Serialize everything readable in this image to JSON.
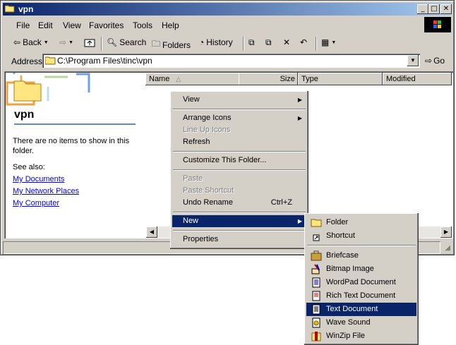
{
  "window": {
    "title": "vpn"
  },
  "menubar": [
    "File",
    "Edit",
    "View",
    "Favorites",
    "Tools",
    "Help"
  ],
  "toolbar": {
    "back": "Back",
    "search": "Search",
    "folders": "Folders",
    "history": "History"
  },
  "address": {
    "label": "Address",
    "value": "C:\\Program Files\\tinc\\vpn",
    "go": "Go"
  },
  "left_panel": {
    "folder_name": "vpn",
    "empty_message": "There are no items to show in this folder.",
    "see_also": "See also:",
    "links": [
      "My Documents",
      "My Network Places",
      "My Computer"
    ]
  },
  "columns": [
    "Name",
    "Size",
    "Type",
    "Modified"
  ],
  "context_menu": {
    "view": "View",
    "arrange_icons": "Arrange Icons",
    "line_up_icons": "Line Up Icons",
    "refresh": "Refresh",
    "customize": "Customize This Folder...",
    "paste": "Paste",
    "paste_shortcut": "Paste Shortcut",
    "undo_rename": "Undo Rename",
    "undo_shortcut": "Ctrl+Z",
    "new": "New",
    "properties": "Properties"
  },
  "new_submenu": {
    "folder": "Folder",
    "shortcut": "Shortcut",
    "briefcase": "Briefcase",
    "bitmap": "Bitmap Image",
    "wordpad": "WordPad Document",
    "rtf": "Rich Text Document",
    "text": "Text Document",
    "wave": "Wave Sound",
    "winzip": "WinZip File"
  },
  "colors": {
    "title_active": "#0a246a",
    "selection": "#0a246a",
    "link": "#0000ff",
    "face": "#d4d0c8"
  }
}
